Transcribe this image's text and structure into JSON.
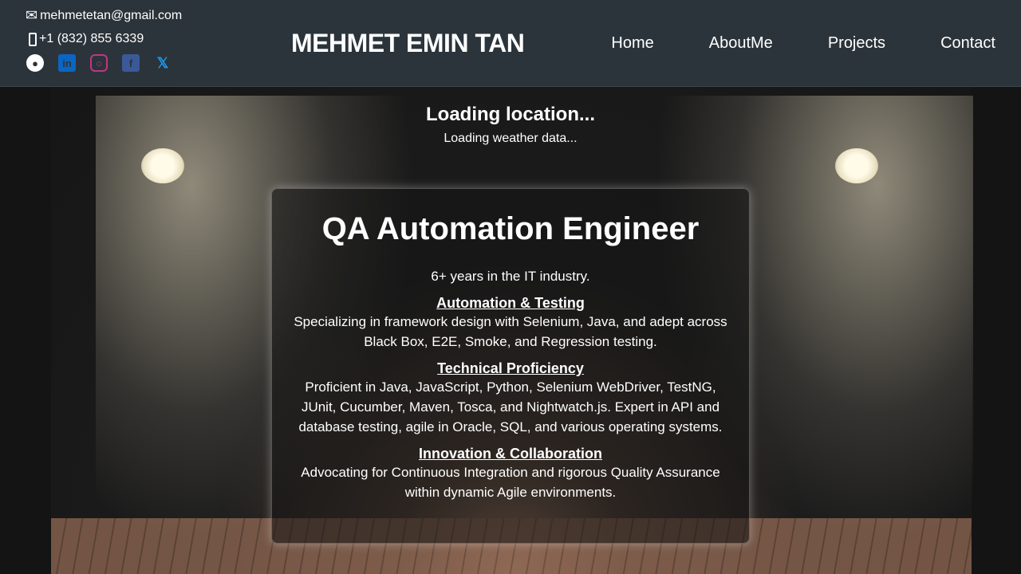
{
  "header": {
    "email": "mehmetetan@gmail.com",
    "phone": "+1 (832) 855 6339",
    "brand": "MEHMET EMIN TAN",
    "socials": [
      {
        "name": "github",
        "color": "#ffffff"
      },
      {
        "name": "linkedin",
        "color": "#0a66c2"
      },
      {
        "name": "instagram",
        "color": "#c13584"
      },
      {
        "name": "facebook",
        "color": "#3b5998"
      },
      {
        "name": "x",
        "color": "#1d9bf0"
      }
    ],
    "nav": [
      "Home",
      "AboutMe",
      "Projects",
      "Contact"
    ]
  },
  "weather": {
    "location": "Loading location...",
    "data": "Loading weather data..."
  },
  "card": {
    "title": "QA Automation Engineer",
    "intro": "6+ years in the IT industry.",
    "sections": [
      {
        "heading": "Automation & Testing",
        "text": "Specializing in framework design with Selenium, Java, and adept across Black Box, E2E, Smoke, and Regression testing."
      },
      {
        "heading": "Technical Proficiency",
        "text": "Proficient in Java, JavaScript, Python, Selenium WebDriver, TestNG, JUnit, Cucumber, Maven, Tosca, and Nightwatch.js. Expert in API and database testing, agile in Oracle, SQL, and various operating systems."
      },
      {
        "heading": "Innovation & Collaboration",
        "text": "Advocating for Continuous Integration and rigorous Quality Assurance within dynamic Agile environments."
      }
    ]
  }
}
